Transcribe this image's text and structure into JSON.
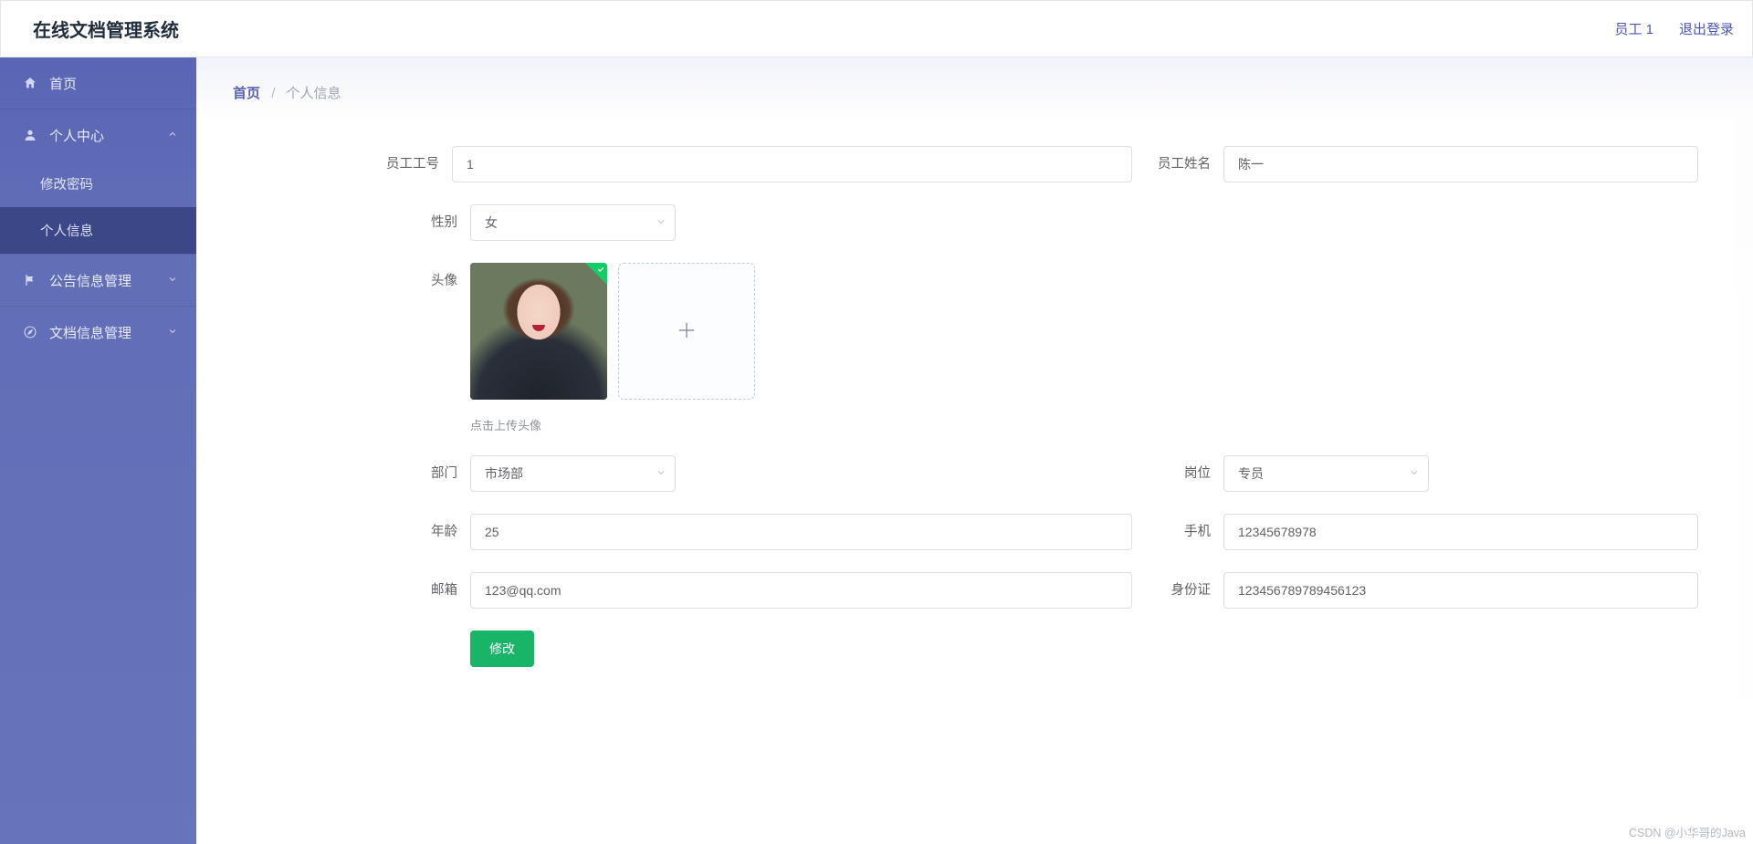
{
  "header": {
    "title": "在线文档管理系统",
    "user": "员工 1",
    "logout": "退出登录"
  },
  "sidebar": {
    "home": "首页",
    "personal": {
      "label": "个人中心",
      "children": {
        "changePwd": "修改密码",
        "profile": "个人信息"
      }
    },
    "notice": "公告信息管理",
    "doc": "文档信息管理"
  },
  "breadcrumb": {
    "home": "首页",
    "sep": "/",
    "current": "个人信息"
  },
  "form": {
    "labels": {
      "empNo": "员工工号",
      "empName": "员工姓名",
      "gender": "性别",
      "avatar": "头像",
      "avatarTip": "点击上传头像",
      "dept": "部门",
      "post": "岗位",
      "age": "年龄",
      "mobile": "手机",
      "email": "邮箱",
      "idcard": "身份证",
      "submit": "修改"
    },
    "values": {
      "empNo": "1",
      "empName": "陈一",
      "gender": "女",
      "dept": "市场部",
      "post": "专员",
      "age": "25",
      "mobile": "12345678978",
      "email": "123@qq.com",
      "idcard": "123456789789456123"
    }
  },
  "watermark": "CSDN @小华哥的Java"
}
